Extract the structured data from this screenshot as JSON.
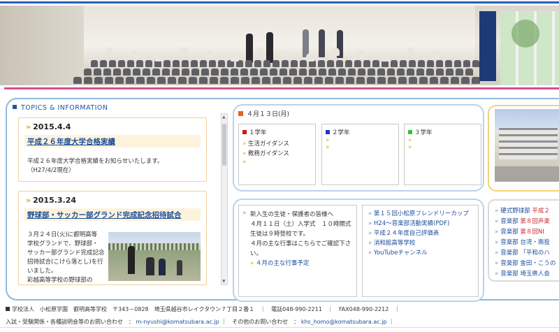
{
  "header": {
    "image_alt": "hall"
  },
  "topics": {
    "heading": "TOPICS & INFORMATION"
  },
  "news": [
    {
      "date": "2015.4.4",
      "title": "平成２６年度大学合格実績",
      "body": [
        "平成２６年度大学合格実績をお知らせいたします。",
        "（H27/4/2現在）"
      ]
    },
    {
      "date": "2015.3.24",
      "title": "野球部・サッカー部グランド完成記念招待試合",
      "body": [
        "３月２４日(火)に叡明高等",
        "学校グランドで、野球部・",
        "サッカー部グランド完成記念",
        "招待試合(こけら落とし)を行",
        "いました。",
        "彩越高等学校の野球部の"
      ]
    }
  ],
  "schedule": {
    "date": "４月１３日(月)",
    "grades": [
      {
        "label": "１学年",
        "color": "#d6141c",
        "items": [
          "生活ガイダンス",
          "教務ガイダンス",
          ""
        ]
      },
      {
        "label": "２学年",
        "color": "#1c37c9",
        "items": [
          "",
          ""
        ]
      },
      {
        "label": "３学年",
        "color": "#2fc23a",
        "items": [
          "",
          ""
        ]
      }
    ]
  },
  "notice": {
    "lines": [
      "新入生の生徒・保護者の皆様へ",
      "４月１１日（土）入学式　１０時開式",
      "生徒は９時登校です。",
      "４月の主な行事はこちらでご確認下さ",
      "い。"
    ],
    "link": "４月の主な行事予定"
  },
  "links": [
    "第１５回小松原フレンドリーカップ",
    "H24～音楽部活動実績(PDF)",
    "平成２４年度自己評価表",
    "消和館高等学校",
    "YouTubeチャンネル"
  ],
  "right_list": [
    {
      "category": "硬式野球部",
      "text": "平成２"
    },
    {
      "category": "音楽部",
      "text": "第８回声楽"
    },
    {
      "category": "音楽部",
      "text": "第８回NI"
    },
    {
      "category": "音楽部",
      "text": "台湾・南投"
    },
    {
      "category": "音楽部",
      "text": "「平和のハ"
    },
    {
      "category": "音楽部",
      "text": "金田・こうの"
    },
    {
      "category": "音楽部",
      "text": "埼玉県人会"
    }
  ],
  "footer": {
    "address": "学校法人　小松原学園　叡明高等学校　〒343－0828　埼玉県越谷市レイクタウン７丁目２番１　｜　電話048-990-2211　｜　FAX048-990-2212　｜",
    "contact_label": "入試・受験関係・各種説明会等のお問い合わせ　：",
    "contact_email": "m-nyushi@komatsubara.ac.jp",
    "other_label": "｜　その他のお問い合わせ　：",
    "other_email": "khs_homo@komatsubara.ac.jp",
    "tail": "｜"
  },
  "colors": {
    "accent_blue": "#1b55a6",
    "accent_pink": "#d64d8f",
    "accent_orange": "#e79c1b",
    "news_border": "#f1cf9a"
  }
}
